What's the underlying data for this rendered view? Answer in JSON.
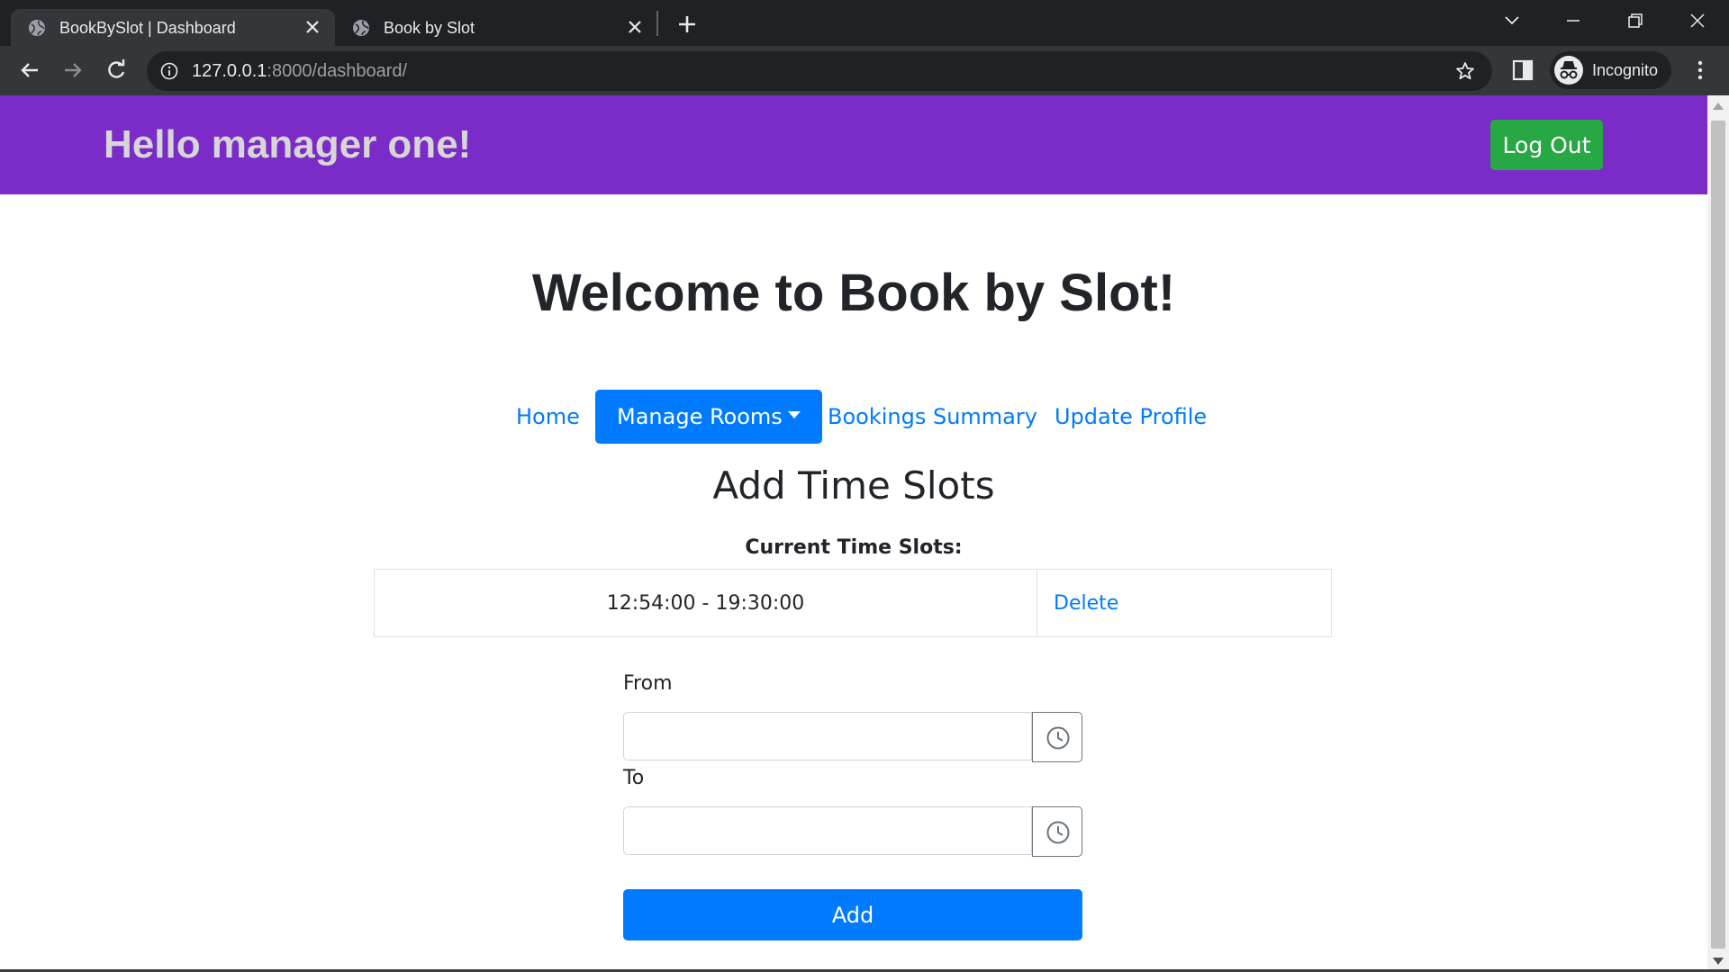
{
  "browser": {
    "tabs": [
      {
        "title": "BookBySlot | Dashboard",
        "active": true
      },
      {
        "title": "Book by Slot",
        "active": false
      }
    ],
    "url": {
      "host": "127.0.0.1",
      "path": ":8000/dashboard/"
    },
    "profile_label": "Incognito"
  },
  "header": {
    "greeting": "Hello manager one!",
    "logout_label": "Log Out",
    "color": "#7b2bc7"
  },
  "welcome_title": "Welcome to Book by Slot!",
  "nav": {
    "home": "Home",
    "manage_rooms": "Manage Rooms",
    "bookings_summary": "Bookings Summary",
    "update_profile": "Update Profile"
  },
  "section_title": "Add Time Slots",
  "current_slots_label": "Current Time Slots:",
  "time_slots": [
    {
      "range": "12:54:00 - 19:30:00",
      "action": "Delete"
    }
  ],
  "form": {
    "from_label": "From",
    "from_value": "",
    "to_label": "To",
    "to_value": "",
    "submit_label": "Add"
  },
  "colors": {
    "primary": "#007bff",
    "success": "#28a745",
    "chrome_dark": "#202124"
  },
  "icons": [
    "globe-icon",
    "close-icon",
    "new-tab-icon",
    "back-icon",
    "forward-icon",
    "reload-icon",
    "site-info-icon",
    "star-icon",
    "side-panel-icon",
    "incognito-icon",
    "more-menu-icon",
    "clock-icon"
  ]
}
